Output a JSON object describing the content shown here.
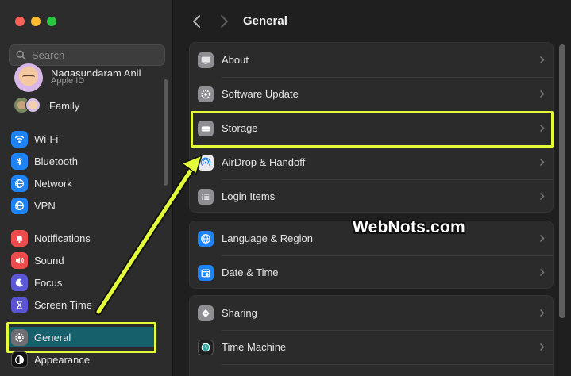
{
  "window": {
    "traffic_lights": [
      "close",
      "minimize",
      "zoom"
    ]
  },
  "search": {
    "placeholder": "Search",
    "value": ""
  },
  "profile": {
    "name": "Nagasundaram Anil",
    "subtitle": "Apple ID"
  },
  "family": {
    "label": "Family"
  },
  "sidebar": {
    "items": [
      {
        "label": "Wi-Fi",
        "icon": "wifi-icon"
      },
      {
        "label": "Bluetooth",
        "icon": "bluetooth-icon"
      },
      {
        "label": "Network",
        "icon": "globe-icon"
      },
      {
        "label": "VPN",
        "icon": "vpn-icon"
      },
      {
        "label": "Notifications",
        "icon": "bell-icon"
      },
      {
        "label": "Sound",
        "icon": "speaker-icon"
      },
      {
        "label": "Focus",
        "icon": "moon-icon"
      },
      {
        "label": "Screen Time",
        "icon": "hourglass-icon"
      },
      {
        "label": "General",
        "icon": "gear-icon",
        "selected": true
      },
      {
        "label": "Appearance",
        "icon": "appearance-icon"
      }
    ]
  },
  "header": {
    "title": "General"
  },
  "main": {
    "group1": [
      {
        "label": "About",
        "icon": "about-icon"
      },
      {
        "label": "Software Update",
        "icon": "software-update-icon"
      },
      {
        "label": "Storage",
        "icon": "storage-icon"
      },
      {
        "label": "AirDrop & Handoff",
        "icon": "airdrop-icon"
      },
      {
        "label": "Login Items",
        "icon": "list-icon"
      }
    ],
    "group2": [
      {
        "label": "Language & Region",
        "icon": "globe-icon"
      },
      {
        "label": "Date & Time",
        "icon": "calendar-icon"
      }
    ],
    "group3": [
      {
        "label": "Sharing",
        "icon": "sharing-icon"
      },
      {
        "label": "Time Machine",
        "icon": "time-machine-icon"
      }
    ]
  },
  "watermark": "WebNots.com",
  "colors": {
    "highlight": "#e4fb3a",
    "selected_bg": "#15606a",
    "accent_blue": "#1e84f5"
  }
}
